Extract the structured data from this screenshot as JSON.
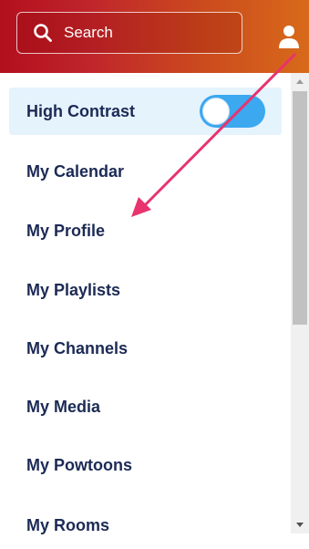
{
  "search": {
    "placeholder": "Search",
    "icon": "search-icon"
  },
  "header": {
    "user_icon": "user-icon",
    "gradient": [
      "#b30f1e",
      "#d86a1a"
    ]
  },
  "menu": {
    "high_contrast": {
      "label": "High Contrast",
      "enabled": true,
      "toggle_color": "#3ba8f0"
    },
    "items": [
      {
        "label": "My Calendar"
      },
      {
        "label": "My Profile"
      },
      {
        "label": "My Playlists"
      },
      {
        "label": "My Channels"
      },
      {
        "label": "My Media"
      },
      {
        "label": "My Powtoons"
      },
      {
        "label": "My Rooms"
      }
    ]
  },
  "annotation": {
    "color": "#e8336e"
  },
  "colors": {
    "menu_text": "#1c2a55",
    "highlight_bg": "#e5f3fd"
  }
}
